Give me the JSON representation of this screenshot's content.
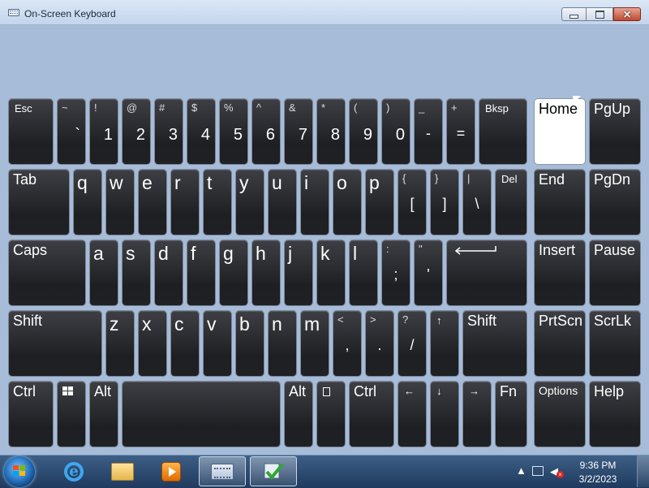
{
  "window": {
    "title": "On-Screen Keyboard",
    "app_icon": "keyboard-icon",
    "controls": [
      "minimize-icon",
      "maximize-icon",
      "close-icon"
    ]
  },
  "keys": {
    "esc": "Esc",
    "tilde": {
      "shift": "~",
      "main": "`"
    },
    "d1": {
      "shift": "!",
      "main": "1"
    },
    "d2": {
      "shift": "@",
      "main": "2"
    },
    "d3": {
      "shift": "#",
      "main": "3"
    },
    "d4": {
      "shift": "$",
      "main": "4"
    },
    "d5": {
      "shift": "%",
      "main": "5"
    },
    "d6": {
      "shift": "^",
      "main": "6"
    },
    "d7": {
      "shift": "&",
      "main": "7"
    },
    "d8": {
      "shift": "*",
      "main": "8"
    },
    "d9": {
      "shift": "(",
      "main": "9"
    },
    "d0": {
      "shift": ")",
      "main": "0"
    },
    "minus": {
      "shift": "_",
      "main": "-"
    },
    "equals": {
      "shift": "+",
      "main": "="
    },
    "bksp": "Bksp",
    "home": "Home",
    "pgup": "PgUp",
    "tab": "Tab",
    "q": "q",
    "w": "w",
    "e": "e",
    "r": "r",
    "t": "t",
    "y": "y",
    "u": "u",
    "i": "i",
    "o": "o",
    "p": "p",
    "lbracket": {
      "shift": "{",
      "main": "["
    },
    "rbracket": {
      "shift": "}",
      "main": "]"
    },
    "backslash": {
      "shift": "|",
      "main": "\\"
    },
    "del": "Del",
    "end": "End",
    "pgdn": "PgDn",
    "caps": "Caps",
    "a": "a",
    "s": "s",
    "d": "d",
    "f": "f",
    "g": "g",
    "h": "h",
    "j": "j",
    "k": "k",
    "l": "l",
    "semicolon": {
      "shift": ":",
      "main": ";"
    },
    "quote": {
      "shift": "\"",
      "main": "'"
    },
    "enter": "Enter",
    "insert": "Insert",
    "pause": "Pause",
    "shift_left": "Shift",
    "z": "z",
    "x": "x",
    "c": "c",
    "v": "v",
    "b": "b",
    "n": "n",
    "m": "m",
    "comma": {
      "shift": "<",
      "main": ","
    },
    "period": {
      "shift": ">",
      "main": "."
    },
    "slash": {
      "shift": "?",
      "main": "/"
    },
    "up": "↑",
    "shift_right": "Shift",
    "prtscn": "PrtScn",
    "scrlk": "ScrLk",
    "ctrl_left": "Ctrl",
    "win": "windows-logo-icon",
    "alt_left": "Alt",
    "space": "",
    "alt_right": "Alt",
    "menu": "menu-icon",
    "ctrl_right": "Ctrl",
    "left": "←",
    "down": "↓",
    "right": "→",
    "fn": "Fn",
    "options": "Options",
    "help": "Help"
  },
  "taskbar": {
    "start": "windows-orb-icon",
    "pinned": [
      "internet-explorer-icon",
      "folder-icon",
      "media-player-icon",
      "on-screen-keyboard-icon",
      "checkmark-icon"
    ],
    "clock_time": "9:36 PM",
    "clock_date": "3/2/2023",
    "tray": [
      "show-hidden-icons-icon",
      "network-icon",
      "volume-muted-icon"
    ],
    "colors": {
      "taskbar": "#1f3a5e",
      "window": "#a6bcd8"
    }
  }
}
